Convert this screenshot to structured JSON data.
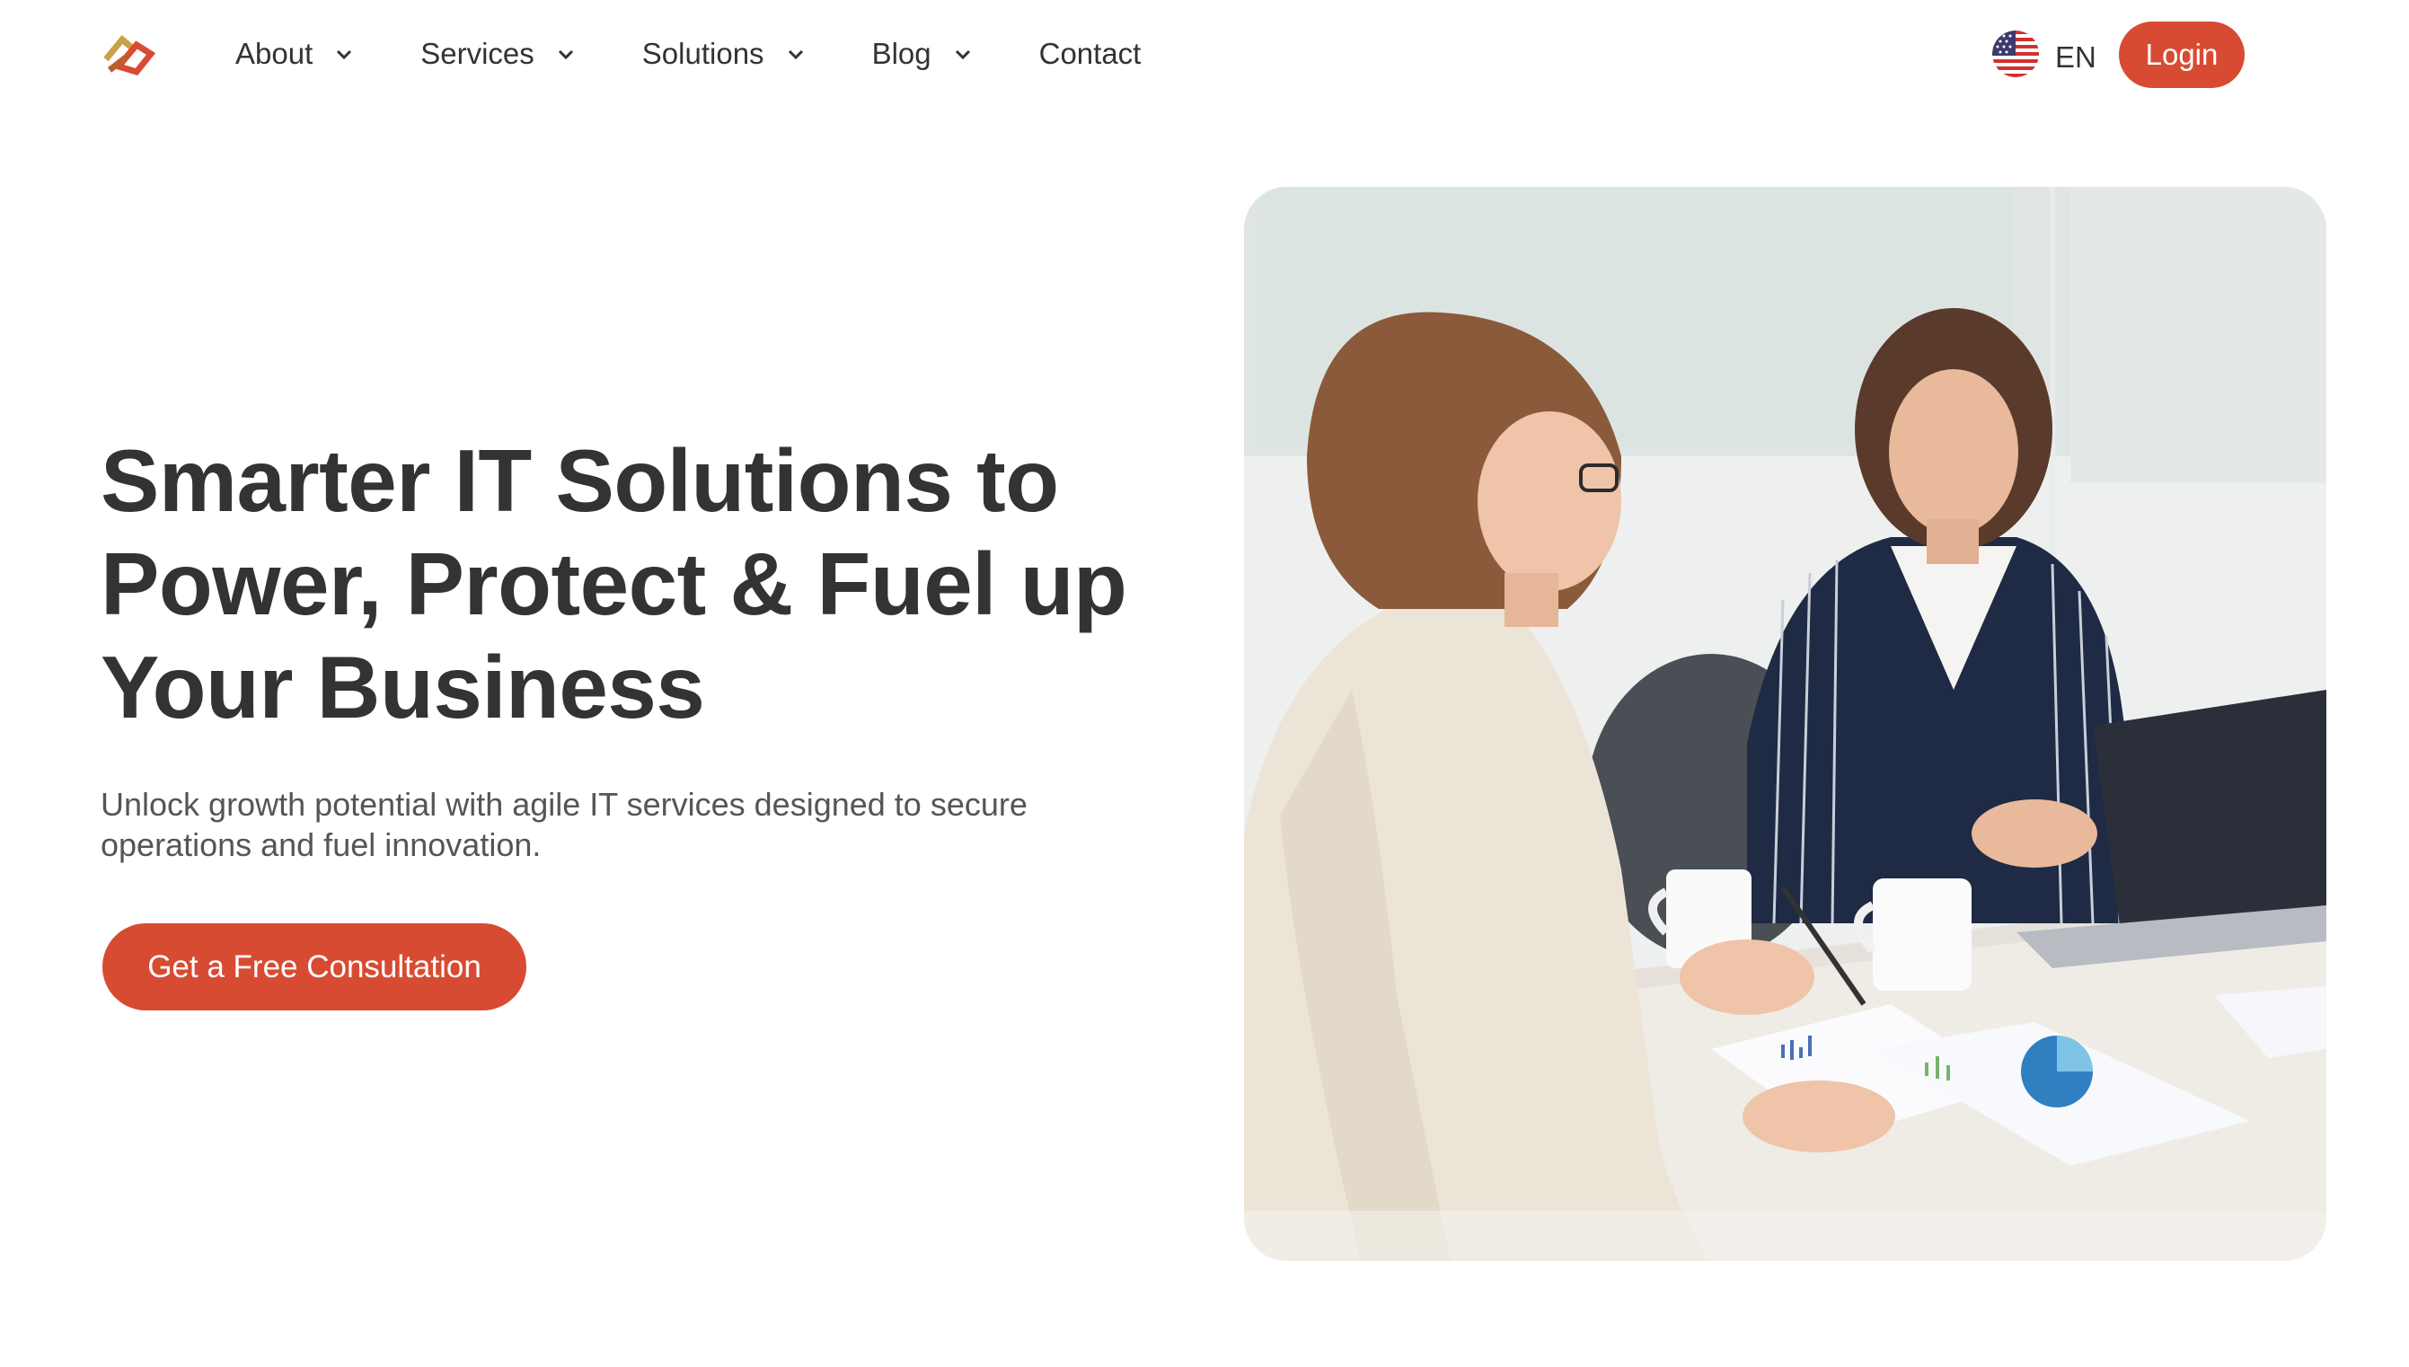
{
  "header": {
    "logo_icon": "brand-logo-icon",
    "nav": [
      {
        "label": "About",
        "has_dropdown": true
      },
      {
        "label": "Services",
        "has_dropdown": true
      },
      {
        "label": "Solutions",
        "has_dropdown": true
      },
      {
        "label": "Blog",
        "has_dropdown": true
      },
      {
        "label": "Contact",
        "has_dropdown": false
      }
    ],
    "language": {
      "flag_icon": "us-flag-icon",
      "label": "EN"
    },
    "login_label": "Login"
  },
  "hero": {
    "title": "Smarter IT Solutions to Power, Protect & Fuel up Your Business",
    "subtitle": "Unlock growth potential with agile IT services designed to secure operations and fuel innovation.",
    "cta_label": "Get a Free Consultation",
    "image_icon": "office-meeting-photo"
  },
  "colors": {
    "accent": "#d84b33",
    "text": "#333333",
    "subtext": "#555555",
    "background": "#ffffff"
  }
}
